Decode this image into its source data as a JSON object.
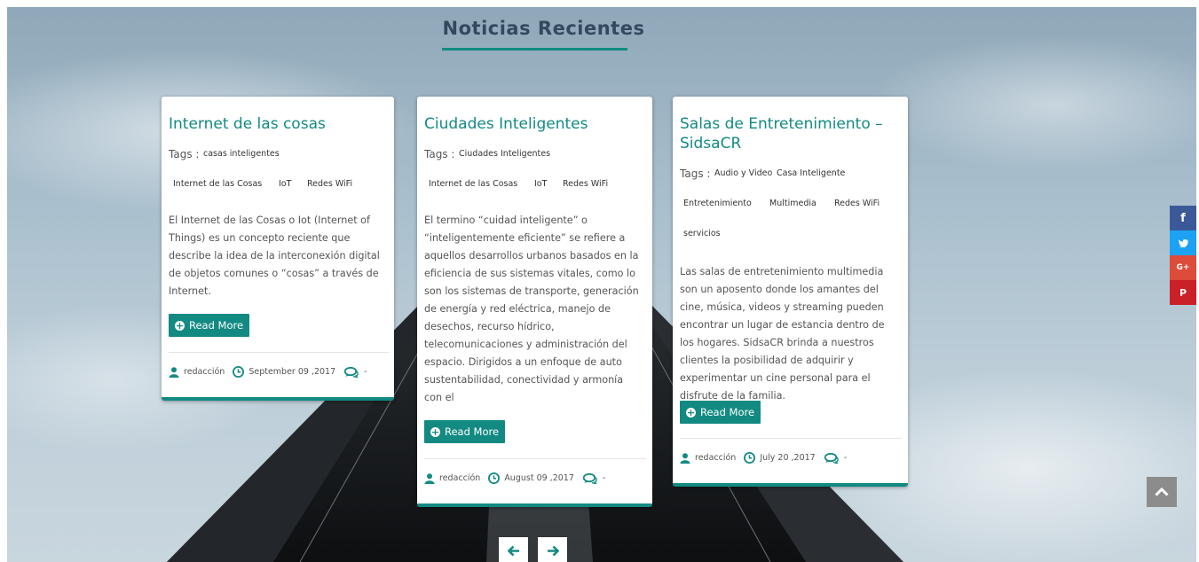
{
  "section": {
    "title": "Noticias Recientes"
  },
  "tags_label": "Tags :",
  "read_more_label": "Read More",
  "cards": [
    {
      "title": "Internet de las cosas",
      "tags": [
        "casas inteligentes",
        "Internet de las Cosas",
        "IoT",
        "Redes WiFi"
      ],
      "description": "El Internet de las Cosas o Iot (Internet of Things) es un concepto reciente que describe la idea de la interconexión digital de objetos comunes o “cosas” a través de Internet.",
      "author": "redacción",
      "date": "September 09 ,2017",
      "comments": "-"
    },
    {
      "title": "Ciudades Inteligentes",
      "tags": [
        "Ciudades Inteligentes",
        "Internet de las Cosas",
        "IoT",
        "Redes WiFi"
      ],
      "description": "El termino “cuidad inteligente” o “inteligentemente eficiente” se refiere a aquellos desarrollos urbanos basados en la eficiencia de sus sistemas vitales, como lo son los sistemas de transporte, generación de energía y red eléctrica, manejo de desechos, recurso hídrico, telecomunicaciones y administración del espacio. Dirigidos a un enfoque de auto sustentabilidad, conectividad y armonía con el",
      "author": "redacción",
      "date": "August 09 ,2017",
      "comments": "-"
    },
    {
      "title": "Salas de Entretenimiento – SidsaCR",
      "tags": [
        "Audio y Video",
        "Casa Inteligente",
        "Entretenimiento",
        "Multimedia",
        "Redes WiFi",
        "servicios"
      ],
      "description": "Las salas de entretenimiento multimedia son un aposento donde los amantes del cine, música, videos y streaming pueden encontrar un lugar de estancia dentro de los hogares. SidsaCR brinda a nuestros clientes la posibilidad de adquirir y experimentar un cine personal para el disfrute de la familia.",
      "author": "redacción",
      "date": "July 20 ,2017",
      "comments": "-"
    }
  ],
  "social": [
    {
      "name": "facebook",
      "glyph": "f",
      "color": "#3b5998"
    },
    {
      "name": "twitter",
      "glyph": "•",
      "color": "#1da1f2"
    },
    {
      "name": "google-plus",
      "glyph": "G+",
      "color": "#dd4b39"
    },
    {
      "name": "pinterest",
      "glyph": "P",
      "color": "#cb2027"
    }
  ],
  "colors": {
    "accent": "#128a82",
    "title": "#34495e"
  }
}
